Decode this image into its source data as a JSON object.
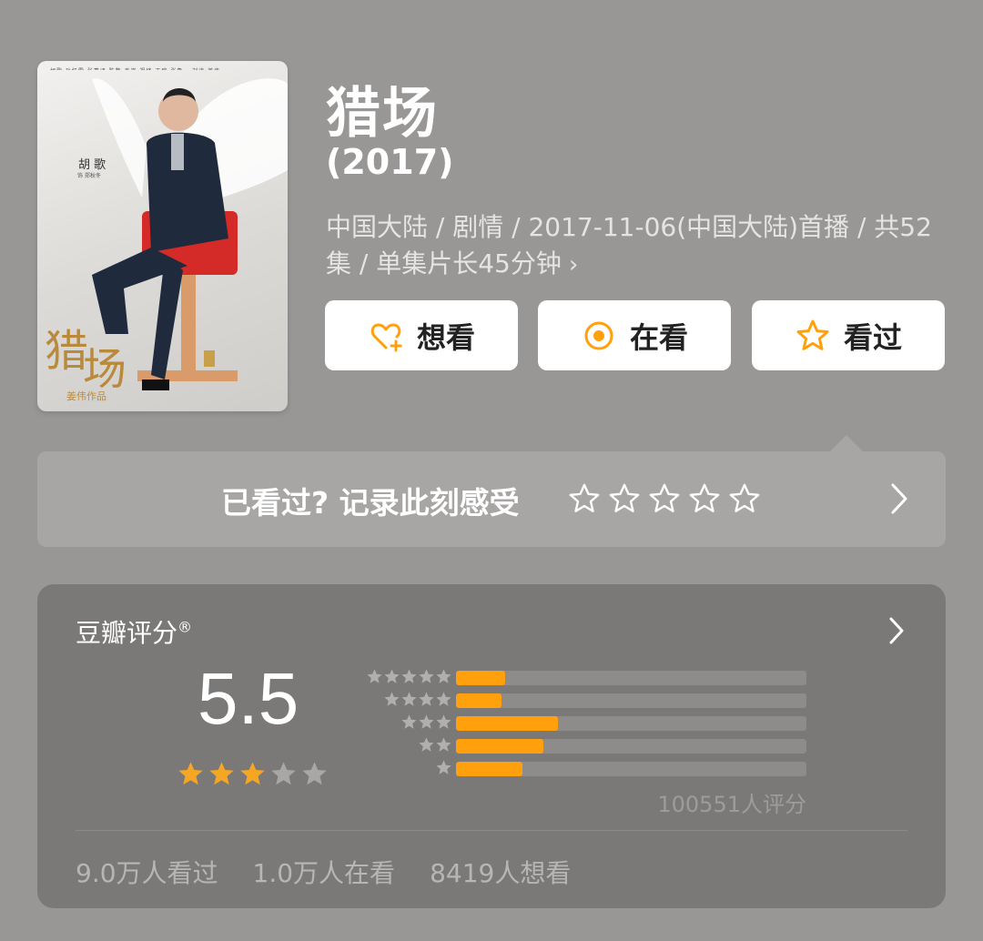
{
  "poster": {
    "credits_text": "胡歌 孙红雷 张嘉译 陈数 秦岚 祖峰 王鸥 张鲁一 刘涛 姜伟",
    "actor_name": "胡歌",
    "actor_role": "饰 郑秋冬",
    "logo_text": "猎场",
    "director_credit": "姜伟作品"
  },
  "title": "猎场",
  "year": "(2017)",
  "meta": {
    "line": "中国大陆 / 剧情 / 2017-11-06(中国大陆)首播 / 共52集 / 单集片长45分钟",
    "chevron": "›"
  },
  "actions": {
    "want_label": "想看",
    "watching_label": "在看",
    "watched_label": "看过"
  },
  "rate_prompt": {
    "text": "已看过? 记录此刻感受",
    "star_count": 5
  },
  "douban": {
    "label": "豆瓣评分",
    "registered_mark": "®",
    "score": "5.5",
    "stars": {
      "filled": 3,
      "total": 5
    },
    "distribution": [
      {
        "stars": 5,
        "percent": 14
      },
      {
        "stars": 4,
        "percent": 13
      },
      {
        "stars": 3,
        "percent": 29
      },
      {
        "stars": 2,
        "percent": 25
      },
      {
        "stars": 1,
        "percent": 19
      }
    ],
    "rating_count": "100551人评分",
    "watched": "9.0万人看过",
    "watching": "1.0万人在看",
    "want": "8419人想看"
  },
  "colors": {
    "background": "#999796",
    "accent_orange": "#ffa00c",
    "star_gold": "#f5a623",
    "card": "#7b7978"
  }
}
